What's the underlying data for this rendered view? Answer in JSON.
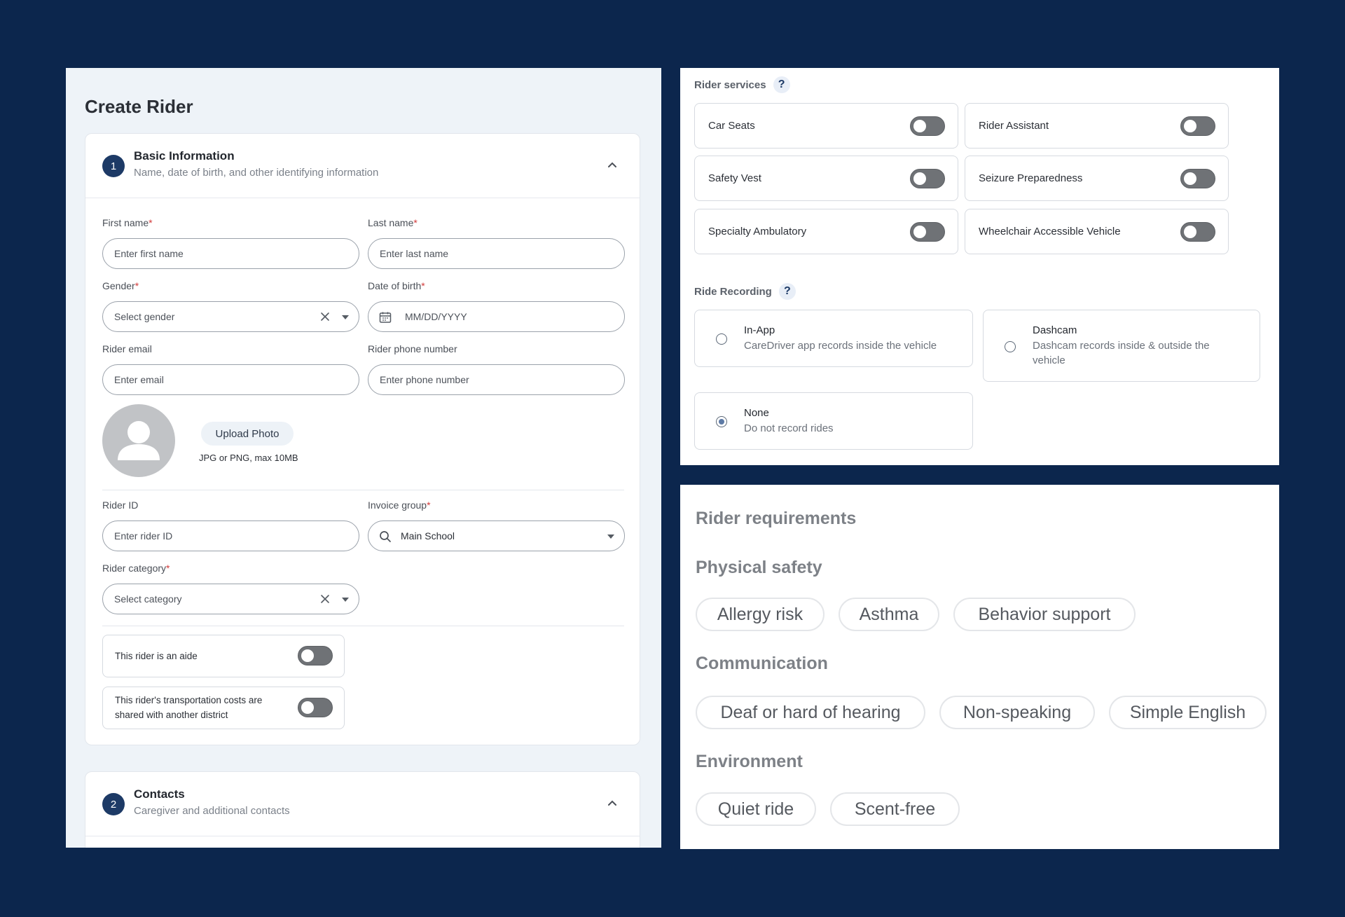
{
  "create_rider": {
    "title": "Create Rider",
    "basic_info": {
      "step": "1",
      "title": "Basic Information",
      "subtitle": "Name, date of birth, and other identifying information"
    },
    "fields": {
      "first_name": {
        "label": "First name",
        "placeholder": "Enter first name"
      },
      "last_name": {
        "label": "Last name",
        "placeholder": "Enter last name"
      },
      "gender": {
        "label": "Gender",
        "placeholder": "Select gender"
      },
      "dob": {
        "label": "Date of birth",
        "placeholder": "MM/DD/YYYY"
      },
      "email": {
        "label": "Rider email",
        "placeholder": "Enter email"
      },
      "phone": {
        "label": "Rider phone number",
        "placeholder": "Enter phone number"
      },
      "rider_id": {
        "label": "Rider ID",
        "placeholder": "Enter rider ID"
      },
      "invoice_group": {
        "label": "Invoice group",
        "value": "Main School"
      },
      "rider_category": {
        "label": "Rider category",
        "placeholder": "Select category"
      }
    },
    "required_mark": "*",
    "photo": {
      "button": "Upload Photo",
      "hint": "JPG or PNG, max 10MB"
    },
    "toggles": [
      {
        "label": "This rider is an aide",
        "on": false
      },
      {
        "label": "This rider's transportation costs are shared with another district",
        "on": false
      }
    ],
    "contacts": {
      "step": "2",
      "title": "Contacts",
      "subtitle": "Caregiver and additional contacts"
    }
  },
  "rider_services": {
    "label": "Rider services",
    "help": "?",
    "items": [
      {
        "label": "Car Seats",
        "on": false
      },
      {
        "label": "Rider Assistant",
        "on": false
      },
      {
        "label": "Safety Vest",
        "on": false
      },
      {
        "label": "Seizure Preparedness",
        "on": false
      },
      {
        "label": "Specialty Ambulatory",
        "on": false
      },
      {
        "label": "Wheelchair Accessible Vehicle",
        "on": false
      }
    ]
  },
  "ride_recording": {
    "label": "Ride Recording",
    "help": "?",
    "selected": "None",
    "options": [
      {
        "title": "In-App",
        "desc": "CareDriver app records inside the vehicle"
      },
      {
        "title": "Dashcam",
        "desc": "Dashcam records inside & outside the vehicle"
      },
      {
        "title": "None",
        "desc": "Do not record rides"
      }
    ]
  },
  "rider_requirements": {
    "title": "Rider requirements",
    "groups": [
      {
        "name": "Physical safety",
        "chips": [
          "Allergy risk",
          "Asthma",
          "Behavior support"
        ]
      },
      {
        "name": "Communication",
        "chips": [
          "Deaf or hard of hearing",
          "Non-speaking",
          "Simple English"
        ]
      },
      {
        "name": "Environment",
        "chips": [
          "Quiet ride",
          "Scent-free"
        ]
      }
    ]
  },
  "colors": {
    "page_bg": "#0c264d",
    "step_badge": "#1d3a66",
    "required": "#d23b3b",
    "toggle_off": "#6f7276"
  }
}
